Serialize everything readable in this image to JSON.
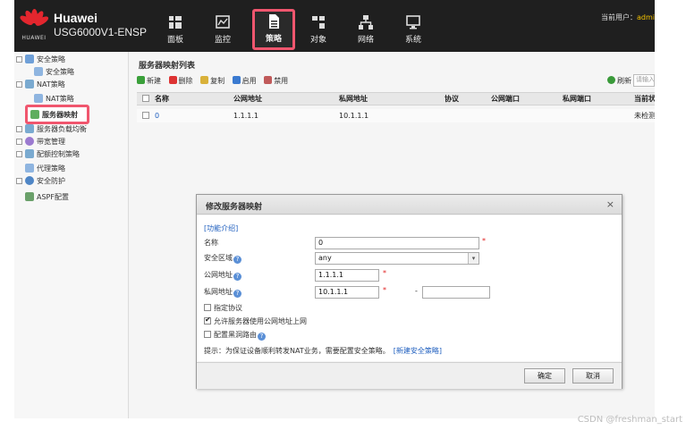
{
  "header": {
    "brand": "HUAWEI",
    "product_line1": "Huawei",
    "product_line2": "USG6000V1-ENSP",
    "nav": [
      {
        "label": "面板",
        "icon": "dashboard-icon"
      },
      {
        "label": "监控",
        "icon": "monitor-icon"
      },
      {
        "label": "策略",
        "icon": "policy-icon"
      },
      {
        "label": "对象",
        "icon": "object-icon"
      },
      {
        "label": "网络",
        "icon": "network-icon"
      },
      {
        "label": "系统",
        "icon": "system-icon"
      }
    ],
    "current_user_label": "当前用户：",
    "current_user": "admi"
  },
  "sidebar": {
    "items": [
      {
        "label": "安全策略"
      },
      {
        "label": "安全策略"
      },
      {
        "label": "NAT策略"
      },
      {
        "label": "NAT策略"
      },
      {
        "label": "服务器映射"
      },
      {
        "label": "服务器负载均衡"
      },
      {
        "label": "带宽管理"
      },
      {
        "label": "配额控制策略"
      },
      {
        "label": "代理策略"
      },
      {
        "label": "安全防护"
      },
      {
        "label": "ASPF配置"
      }
    ]
  },
  "main": {
    "title": "服务器映射列表",
    "toolbar": {
      "new": "新建",
      "delete": "删除",
      "copy": "复制",
      "enable": "启用",
      "disable": "禁用",
      "refresh": "刷新",
      "search_placeholder": "请输入"
    },
    "columns": [
      "名称",
      "公网地址",
      "私网地址",
      "协议",
      "公网端口",
      "私网端口",
      "当前状态"
    ],
    "rows": [
      {
        "name": "0",
        "public_ip": "1.1.1.1",
        "private_ip": "10.1.1.1",
        "protocol": "",
        "public_port": "",
        "private_port": "",
        "status": "未检测"
      }
    ]
  },
  "dialog": {
    "title": "修改服务器映射",
    "close": "×",
    "intro_link": "[功能介绍]",
    "fields": {
      "name_label": "名称",
      "name_value": "0",
      "zone_label": "安全区域",
      "zone_value": "any",
      "public_label": "公网地址",
      "public_value": "1.1.1.1",
      "private_label": "私网地址",
      "private_value": "10.1.1.1",
      "private_end_sep": "-",
      "private_end_value": ""
    },
    "checkboxes": [
      {
        "label": "指定协议",
        "checked": false
      },
      {
        "label": "允许服务器使用公网地址上网",
        "checked": true
      },
      {
        "label": "配置黑洞路由",
        "checked": false
      }
    ],
    "hint": "提示：为保证设备顺利转发NAT业务，需要配置安全策略。",
    "hint_link": "[新建安全策略]",
    "ok": "确定",
    "cancel": "取消"
  },
  "watermark": "CSDN @freshman_start",
  "colors": {
    "topbar": "#1f1f1f",
    "highlight": "#f0566e",
    "huawei_red": "#e3262e",
    "link": "#1f5fbf"
  }
}
